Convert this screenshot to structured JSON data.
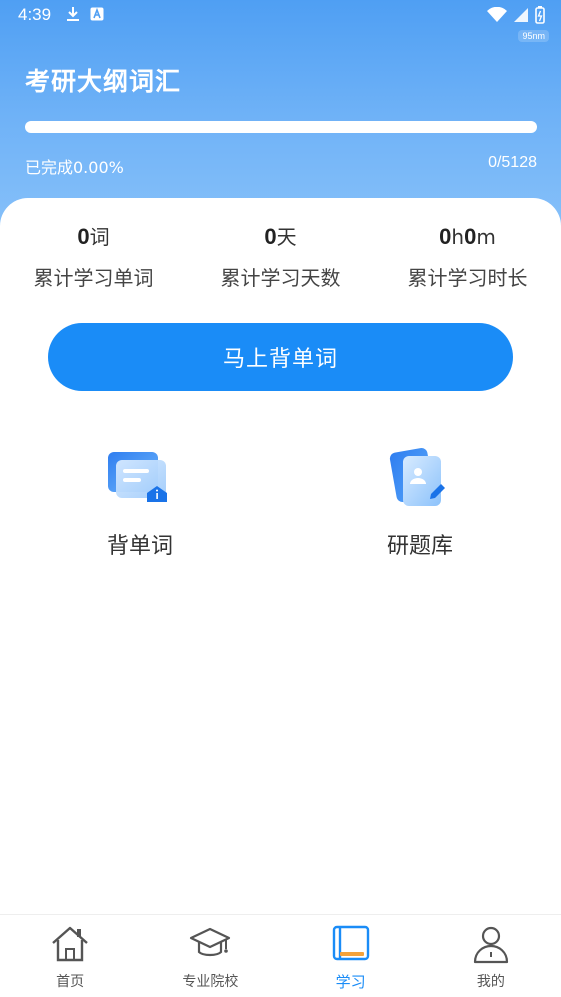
{
  "status_bar": {
    "time": "4:39",
    "net_speed": "95nm",
    "icons": [
      "download-icon",
      "a-icon",
      "wifi-icon",
      "signal-icon",
      "battery-icon"
    ]
  },
  "header": {
    "title": "考研大纲词汇",
    "progress_fraction": 0.0,
    "progress_label": "已完成0.00%",
    "progress_count": "0/5128"
  },
  "stats": [
    {
      "value": "0",
      "unit": "词",
      "label": "累计学习单词"
    },
    {
      "value": "0",
      "unit": "天",
      "label": "累计学习天数"
    },
    {
      "value_h": "0",
      "unit_h": "h",
      "value_m": "0",
      "unit_m": "m",
      "label": "累计学习时长"
    }
  ],
  "cta": {
    "label": "马上背单词"
  },
  "features": [
    {
      "label": "背单词",
      "icon": "flashcard-icon"
    },
    {
      "label": "研题库",
      "icon": "question-bank-icon"
    }
  ],
  "tabbar": {
    "items": [
      {
        "label": "首页",
        "icon": "home-icon"
      },
      {
        "label": "专业院校",
        "icon": "graduation-cap-icon"
      },
      {
        "label": "学习",
        "icon": "book-icon",
        "active": true
      },
      {
        "label": "我的",
        "icon": "user-icon"
      }
    ]
  },
  "colors": {
    "accent": "#1a8cf7",
    "header_top": "#4f9ff3",
    "header_bottom": "#8cc4fa"
  }
}
